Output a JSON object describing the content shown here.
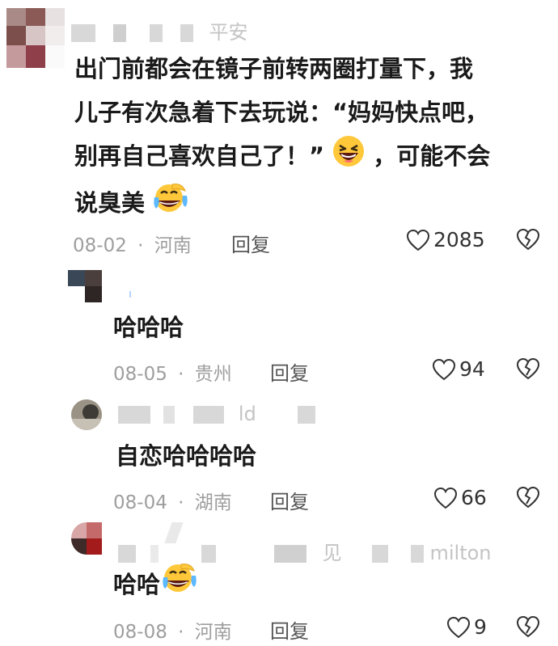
{
  "comments": [
    {
      "name_partial": "平安",
      "text_lines": [
        "出门前都会在镜子前转两圈打量下，我",
        "儿子有次急着下去玩说：“妈妈快点吧，",
        "别再自己喜欢自己了！”",
        "，可能不会",
        "说臭美"
      ],
      "date": "08-02",
      "location": "河南",
      "reply_label": "回复",
      "likes": "2085"
    },
    {
      "text": "哈哈哈",
      "date": "08-05",
      "location": "贵州",
      "reply_label": "回复",
      "likes": "94"
    },
    {
      "name_partial": "ld",
      "text": "自恋哈哈哈哈",
      "date": "08-04",
      "location": "湖南",
      "reply_label": "回复",
      "likes": "66"
    },
    {
      "name_partial": "milton",
      "name_partial_2": "见",
      "text": "哈哈",
      "date": "08-08",
      "location": "河南",
      "reply_label": "回复",
      "likes": "9"
    }
  ],
  "separator": "·",
  "icons": {
    "like": "heart-outline-icon",
    "dislike": "broken-heart-icon",
    "laugh_emoji": "grinning-squint-emoji",
    "laugh_cry_emoji": "laughing-crying-emoji"
  }
}
